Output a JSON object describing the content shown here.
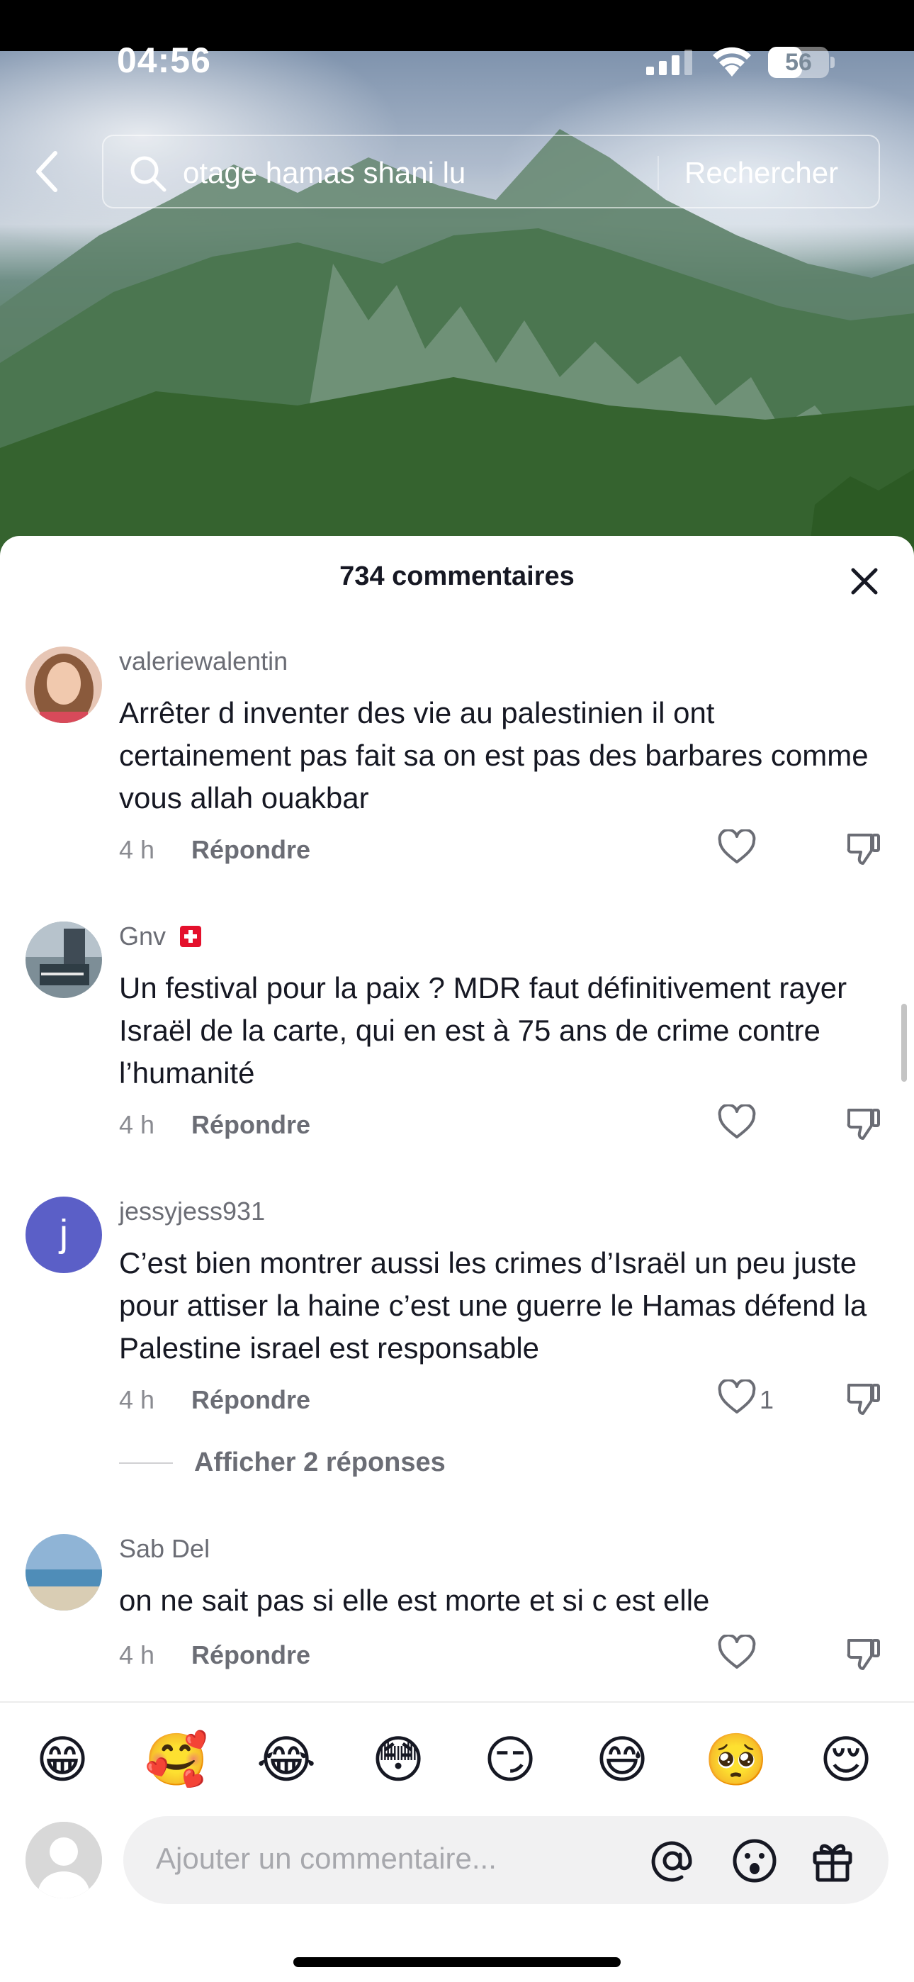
{
  "status_bar": {
    "time": "04:56",
    "battery": "56",
    "battery_level_percent": 56
  },
  "search": {
    "query": "otage hamas shani lu",
    "submit_label": "Rechercher"
  },
  "sheet": {
    "title": "734 commentaires"
  },
  "comments": [
    {
      "username": "valeriewalentin",
      "text": "Arrêter d inventer des vie au palestinien il ont certainement pas fait sa on est pas des barbares comme vous allah ouakbar",
      "time": "4 h",
      "reply_label": "Répondre"
    },
    {
      "username": "Gnv",
      "text": "Un festival pour la paix ? MDR faut définitivement rayer Israël de la carte, qui en est à 75 ans de crime contre l’humanité",
      "time": "4 h",
      "reply_label": "Répondre"
    },
    {
      "username": "jessyjess931",
      "avatar_letter": "j",
      "text": "C’est bien montrer aussi les crimes d’Israël un peu juste pour attiser la haine c’est une guerre le Hamas défend la Palestine israel est responsable",
      "time": "4 h",
      "reply_label": "Répondre",
      "likes": "1",
      "view_replies": "Afficher 2 réponses"
    },
    {
      "username": "Sab Del",
      "text": "on ne sait pas si elle est morte et si c est elle",
      "time": "4 h",
      "reply_label": "Répondre"
    }
  ],
  "emojis": [
    "😁",
    "🥰",
    "😂",
    "😳",
    "😏",
    "😅",
    "🥺",
    "😌"
  ],
  "composer": {
    "placeholder": "Ajouter un commentaire..."
  },
  "colors": {
    "avatar_j": "#5b5fc7",
    "flag_red": "#e4102c"
  }
}
